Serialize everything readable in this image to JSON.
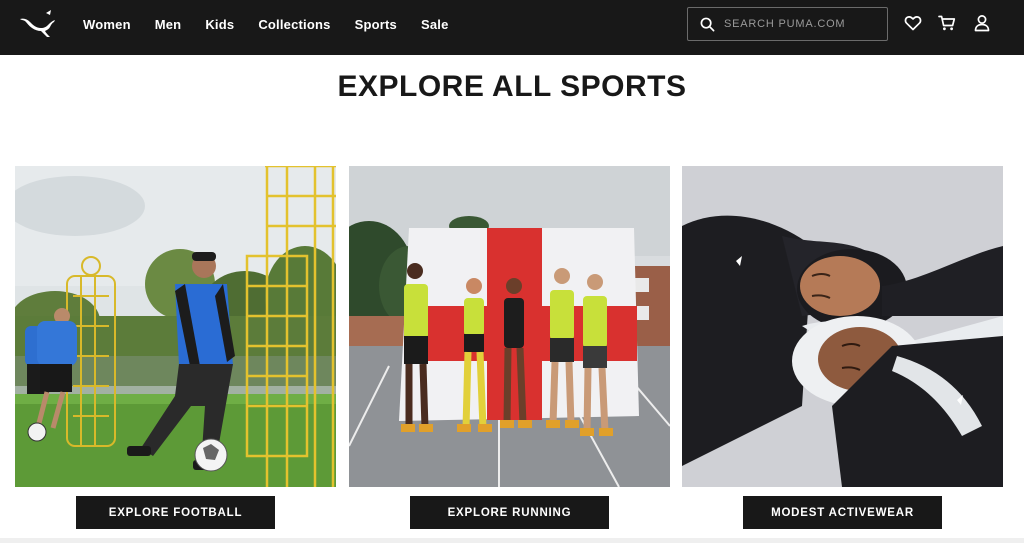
{
  "header": {
    "logo_icon": "puma-cat-logo-icon",
    "nav": [
      {
        "label": "Women"
      },
      {
        "label": "Men"
      },
      {
        "label": "Kids"
      },
      {
        "label": "Collections"
      },
      {
        "label": "Sports"
      },
      {
        "label": "Sale"
      }
    ],
    "search": {
      "placeholder": "SEARCH PUMA.COM",
      "value": "",
      "icon": "search-icon"
    },
    "icons": [
      "wishlist-heart-icon",
      "cart-icon",
      "account-icon"
    ]
  },
  "main": {
    "title": "EXPLORE ALL SPORTS",
    "tiles": [
      {
        "image": "football-player-with-ball-photo",
        "cta": "EXPLORE FOOTBALL"
      },
      {
        "image": "runners-in-front-of-flag-photo",
        "cta": "EXPLORE RUNNING"
      },
      {
        "image": "two-women-in-hijabs-lying-down-photo",
        "cta": "MODEST ACTIVEWEAR"
      }
    ]
  },
  "colors": {
    "header_bg": "#181818",
    "text": "#181818",
    "button_bg": "#181818",
    "button_text": "#ffffff"
  }
}
